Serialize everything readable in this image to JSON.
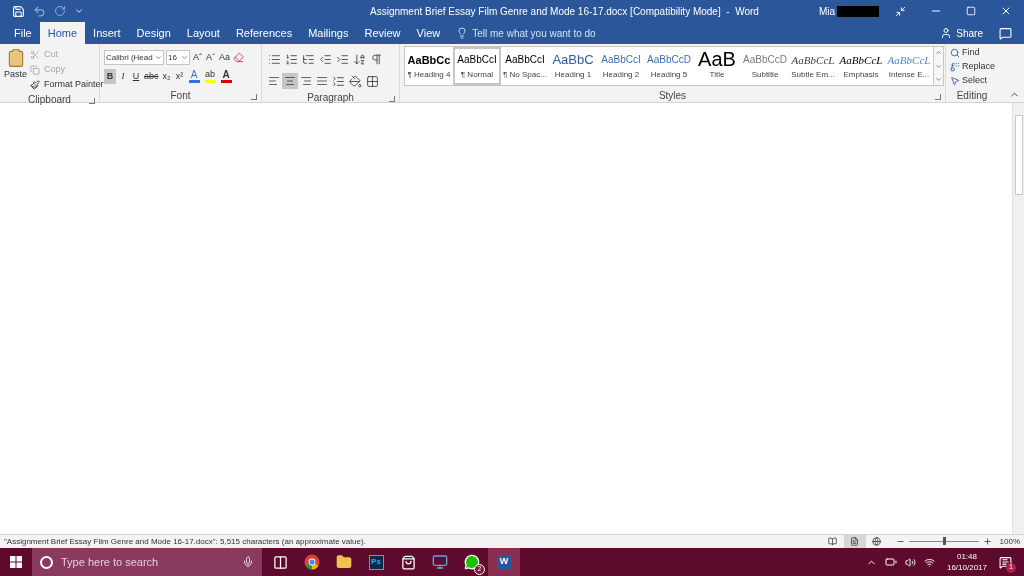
{
  "title_bar": {
    "title": "Assignment Brief Essay Film Genre and Mode 16-17.docx [Compatibility Mode]  -  Word",
    "user": "Mia"
  },
  "tabs": [
    {
      "label": "File",
      "selected": false
    },
    {
      "label": "Home",
      "selected": true
    },
    {
      "label": "Insert",
      "selected": false
    },
    {
      "label": "Design",
      "selected": false
    },
    {
      "label": "Layout",
      "selected": false
    },
    {
      "label": "References",
      "selected": false
    },
    {
      "label": "Mailings",
      "selected": false
    },
    {
      "label": "Review",
      "selected": false
    },
    {
      "label": "View",
      "selected": false
    }
  ],
  "tell_me": {
    "placeholder": "Tell me what you want to do"
  },
  "share": "Share",
  "clipboard": {
    "label": "Clipboard",
    "paste": "Paste",
    "items": [
      {
        "kind": "cut",
        "label": "Cut",
        "disabled": true
      },
      {
        "kind": "copy",
        "label": "Copy",
        "disabled": true
      },
      {
        "kind": "painter",
        "label": "Format Painter",
        "disabled": false
      }
    ]
  },
  "font": {
    "label": "Font",
    "font_name": "Calibri (Head",
    "font_size": "16",
    "size_buttons": [
      "Aˆ",
      "Aˇ",
      "Aa"
    ],
    "format_buttons": [
      {
        "label": "B",
        "kind": "bold",
        "selected": true
      },
      {
        "label": "I",
        "kind": "italic",
        "selected": false
      },
      {
        "label": "U",
        "kind": "underline",
        "selected": false
      },
      {
        "label": "abc",
        "kind": "strike",
        "selected": false
      },
      {
        "label": "x₂",
        "kind": "plain",
        "selected": false
      },
      {
        "label": "x²",
        "kind": "plain",
        "selected": false
      }
    ],
    "color_buttons": [
      {
        "label": "A",
        "kind": "effects",
        "color": "#2e75d6"
      },
      {
        "label": "ab",
        "kind": "highlight",
        "color": "#ffff00"
      },
      {
        "label": "A",
        "kind": "font-color",
        "color": "#e00000"
      }
    ]
  },
  "paragraph": {
    "label": "Paragraph",
    "alignments": [
      {
        "kind": "left",
        "selected": false
      },
      {
        "kind": "center",
        "selected": true
      },
      {
        "kind": "right",
        "selected": false
      },
      {
        "kind": "justify",
        "selected": false
      }
    ]
  },
  "styles": {
    "label": "Styles",
    "items": [
      {
        "sample": "AaBbCc",
        "name": "¶ Heading 4",
        "kind": "bold",
        "color": "#000000",
        "selected": false
      },
      {
        "sample": "AaBbCcI",
        "name": "¶ Normal",
        "kind": "normal",
        "color": "#000000",
        "selected": true
      },
      {
        "sample": "AaBbCcI",
        "name": "¶ No Spac...",
        "kind": "normal",
        "color": "#000000",
        "selected": false
      },
      {
        "sample": "AaBbC",
        "name": "Heading 1",
        "kind": "large",
        "color": "#2e5c9e",
        "selected": false
      },
      {
        "sample": "AaBbCcI",
        "name": "Heading 2",
        "kind": "normal",
        "color": "#3b6fb6",
        "selected": false
      },
      {
        "sample": "AaBbCcD",
        "name": "Heading 5",
        "kind": "normal",
        "color": "#3b6fb6",
        "selected": false
      },
      {
        "sample": "AaB",
        "name": "Title",
        "kind": "title",
        "color": "#000000",
        "selected": false
      },
      {
        "sample": "AaBbCcD",
        "name": "Subtitle",
        "kind": "normal",
        "color": "#7a7a7a",
        "selected": false
      },
      {
        "sample": "AaBbCcL",
        "name": "Subtle Em...",
        "kind": "italic",
        "color": "#404040",
        "selected": false
      },
      {
        "sample": "AaBbCcL",
        "name": "Emphasis",
        "kind": "italic",
        "color": "#000000",
        "selected": false
      },
      {
        "sample": "AaBbCcL",
        "name": "Intense E...",
        "kind": "italic",
        "color": "#4a86d6",
        "selected": false
      }
    ]
  },
  "editing": {
    "label": "Editing",
    "items": [
      {
        "kind": "find",
        "label": "Find"
      },
      {
        "kind": "replace",
        "label": "Replace"
      },
      {
        "kind": "select",
        "label": "Select"
      }
    ]
  },
  "status_bar": {
    "text": "\"Assignment Brief Essay Film Genre and Mode 16-17.docx\": 5,515 characters (an approximate value).",
    "views": [
      {
        "kind": "read",
        "selected": false
      },
      {
        "kind": "print",
        "selected": true
      },
      {
        "kind": "web",
        "selected": false
      }
    ],
    "zoom": {
      "level": 0.5,
      "reading": "100%"
    }
  },
  "taskbar": {
    "search": {
      "placeholder": "Type here to search"
    },
    "apps": [
      {
        "kind": "task-view"
      },
      {
        "kind": "chrome"
      },
      {
        "kind": "folder"
      },
      {
        "kind": "photoshop",
        "label": "Ps"
      },
      {
        "kind": "store"
      },
      {
        "kind": "app"
      },
      {
        "kind": "chat",
        "badge": "2"
      },
      {
        "kind": "word",
        "label": "W"
      }
    ],
    "time": "01:48",
    "date": "16/10/2017",
    "notifications": "1"
  }
}
